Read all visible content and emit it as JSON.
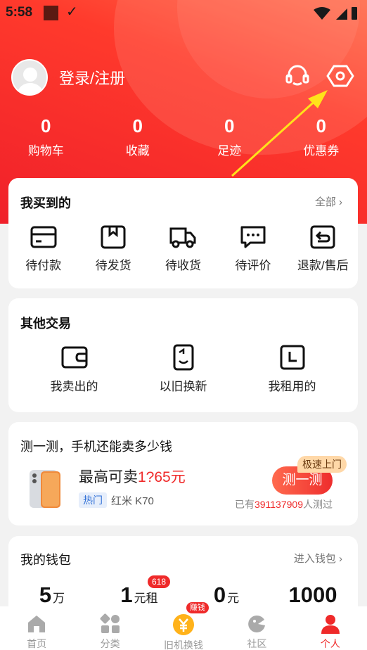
{
  "status": {
    "time": "5:58"
  },
  "user": {
    "login_label": "登录/注册"
  },
  "stats": [
    {
      "num": "0",
      "label": "购物车"
    },
    {
      "num": "0",
      "label": "收藏"
    },
    {
      "num": "0",
      "label": "足迹"
    },
    {
      "num": "0",
      "label": "优惠券"
    }
  ],
  "bought": {
    "title": "我买到的",
    "link": "全部 ›",
    "items": [
      "待付款",
      "待发货",
      "待收货",
      "待评价",
      "退款/售后"
    ]
  },
  "other": {
    "title": "其他交易",
    "items": [
      "我卖出的",
      "以旧换新",
      "我租用的"
    ]
  },
  "estimate": {
    "title": "测一测，手机还能卖多少钱",
    "price_prefix": "最高可卖",
    "price_value": "1?65元",
    "hot": "热门",
    "model": "红米 K70",
    "button": "测一测",
    "badge": "极速上门",
    "tested_prefix": "已有",
    "tested_count": "391137909",
    "tested_suffix": "人测过"
  },
  "wallet": {
    "title": "我的钱包",
    "link": "进入钱包 ›",
    "badge": "618",
    "items": [
      {
        "big": "5",
        "unit": "万"
      },
      {
        "big": "1",
        "unit": "元租"
      },
      {
        "big": "0",
        "unit": "元"
      },
      {
        "big": "1000",
        "unit": ""
      }
    ]
  },
  "tabs": [
    {
      "label": "首页",
      "icon": "home-icon"
    },
    {
      "label": "分类",
      "icon": "category-icon"
    },
    {
      "label": "旧机换钱",
      "icon": "yuan-coin-icon",
      "badge": "赚钱"
    },
    {
      "label": "社区",
      "icon": "community-icon"
    },
    {
      "label": "个人",
      "icon": "person-icon",
      "active": true
    }
  ],
  "colors": {
    "accent": "#ef2a2a",
    "hero": "#ff3a2c"
  }
}
